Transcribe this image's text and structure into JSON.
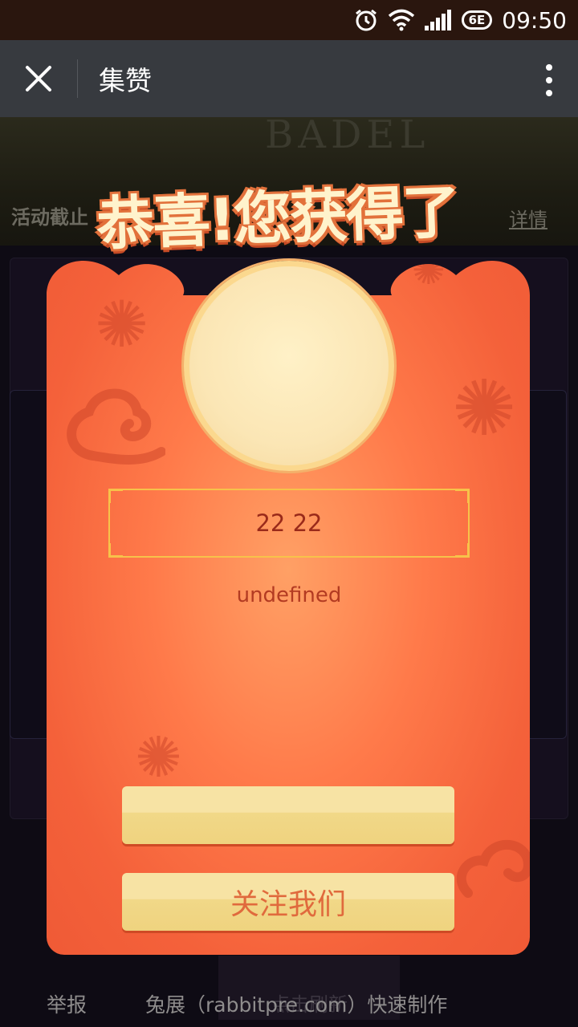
{
  "status_bar": {
    "network": "6E",
    "time": "09:50",
    "icons": [
      "alarm-icon",
      "wifi-icon",
      "signal-icon"
    ]
  },
  "title_bar": {
    "title": "集赞",
    "close_icon": "close-icon",
    "more_icon": "more-icon"
  },
  "background": {
    "banner_text": "BADEL",
    "left_label": "活动截止",
    "right_label": "详情",
    "refresh_label": "点击刷新"
  },
  "modal": {
    "congrats": "恭喜!您获得了",
    "name": "22 22",
    "prize_description": "undefined",
    "primary_button_label": "",
    "follow_button_label": "关注我们",
    "colors": {
      "envelope": "#f4613a",
      "button": "#f7e3a4",
      "button_text": "#e06a3d",
      "frame": "#f7c24a"
    }
  },
  "footer": {
    "report": "举报",
    "made_with": "兔展（rabbitpre.com）快速制作"
  }
}
